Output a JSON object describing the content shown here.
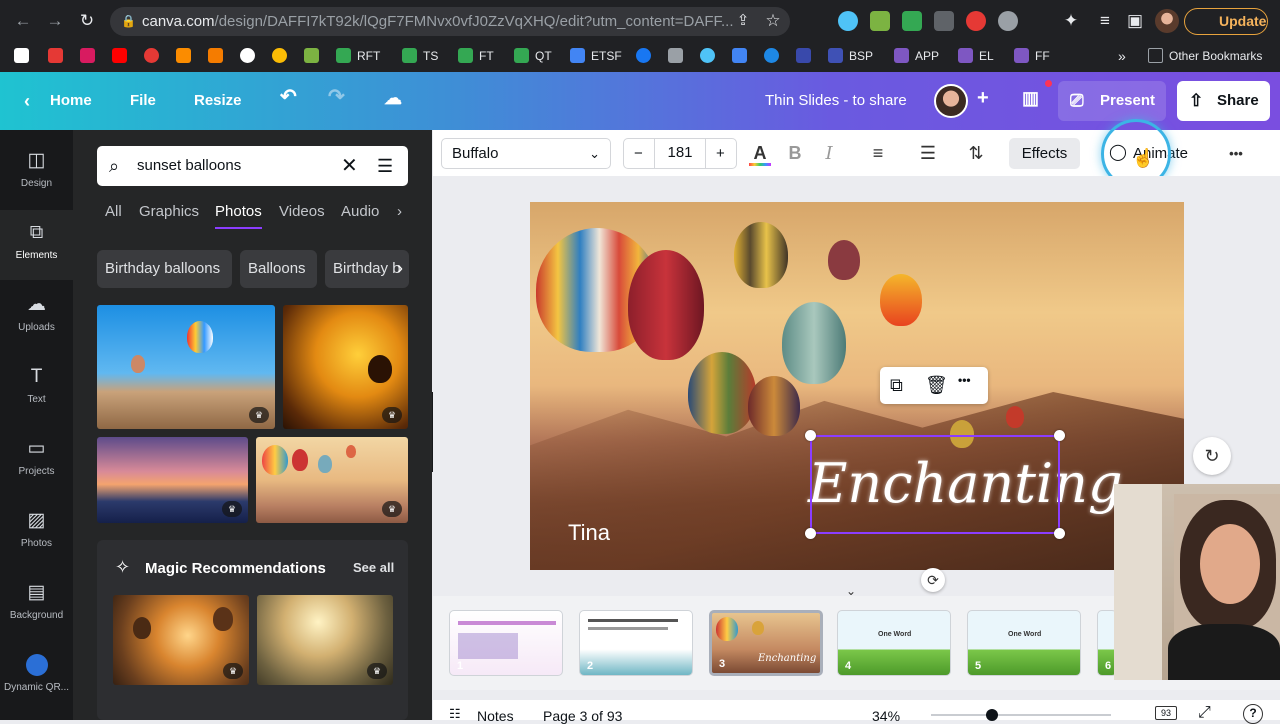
{
  "browser": {
    "url": "canva.com/design/DAFFI7kT92k/lQgF7FMNvx0vfJ0ZzVqXHQ/edit?utm_content=DAFF...",
    "url_host": "canva.com",
    "url_path": "/design/DAFFI7kT92k/lQgF7FMNvx0vfJ0ZzVqXHQ/edit?utm_content=DAFF...",
    "update_label": "Update",
    "bookmarks": [
      "RFT",
      "TS",
      "FT",
      "QT",
      "ETSF",
      "BSP",
      "APP",
      "EL",
      "FF"
    ],
    "other_bookmarks": "Other Bookmarks",
    "more": "»"
  },
  "header": {
    "home": "Home",
    "file": "File",
    "resize": "Resize",
    "design_title": "Thin Slides - to share",
    "present": "Present",
    "share": "Share",
    "accent": "#8b3dff"
  },
  "rail": [
    {
      "label": "Design",
      "icon": "layout-icon"
    },
    {
      "label": "Elements",
      "icon": "shapes-icon"
    },
    {
      "label": "Uploads",
      "icon": "cloud-upload-icon"
    },
    {
      "label": "Text",
      "icon": "text-icon"
    },
    {
      "label": "Projects",
      "icon": "folder-icon"
    },
    {
      "label": "Photos",
      "icon": "image-icon"
    },
    {
      "label": "Background",
      "icon": "pattern-icon"
    },
    {
      "label": "Dynamic QR...",
      "icon": "qr-app-icon"
    }
  ],
  "panel": {
    "search_value": "sunset balloons",
    "tabs": [
      "All",
      "Graphics",
      "Photos",
      "Videos",
      "Audio"
    ],
    "active_tab": "Photos",
    "chips": [
      "Birthday balloons",
      "Balloons",
      "Birthday b"
    ],
    "magic_title": "Magic Recommendations",
    "see_all": "See all"
  },
  "toolbar": {
    "font": "Buffalo",
    "size": "181",
    "minus": "−",
    "plus": "+",
    "effects": "Effects",
    "animate": "Animate",
    "more": "•••"
  },
  "slide": {
    "name": "Tina",
    "title_text": "Enchanting"
  },
  "pages": [
    "1",
    "2",
    "3",
    "4",
    "5",
    "6"
  ],
  "page_texts": {
    "p4": "One Word",
    "p5": "One Word"
  },
  "footer": {
    "notes": "Notes",
    "page_indicator": "Page 3 of 93",
    "zoom": "34%",
    "page_count": "93",
    "help": "?"
  }
}
